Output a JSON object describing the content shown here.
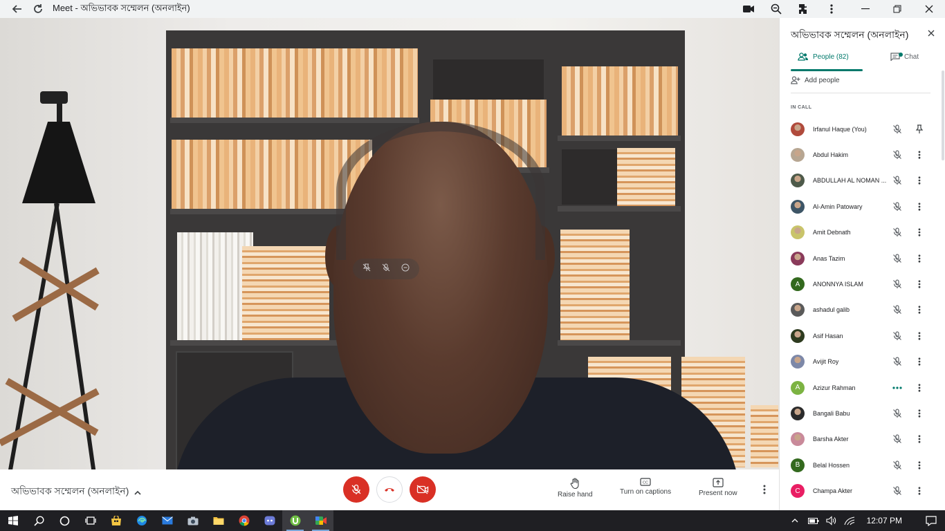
{
  "window": {
    "title": "Meet - অভিভাবক সম্মেলন (অনলাইন)"
  },
  "meeting": {
    "title": "অভিভাবক সম্মেলন (অনলাইন)"
  },
  "controls": {
    "raise_hand": "Raise hand",
    "captions": "Turn on captions",
    "present": "Present now"
  },
  "panel": {
    "title": "অভিভাবক সম্মেলন (অনলাইন)",
    "tab_people": "People (82)",
    "tab_chat": "Chat",
    "add_people": "Add people",
    "section_label": "IN CALL",
    "participants": [
      {
        "name": "Irfanul Haque (You)",
        "avatar": "photo",
        "color": "#b04a3c",
        "status": "muted",
        "action": "pin"
      },
      {
        "name": "Abdul Hakim",
        "avatar": "photo",
        "color": "#b7a692",
        "status": "muted",
        "action": "more"
      },
      {
        "name": "ABDULLAH AL NOMAN ...",
        "avatar": "photo",
        "color": "#4e5a4a",
        "status": "muted",
        "action": "more"
      },
      {
        "name": "Al-Amin Patowary",
        "avatar": "photo",
        "color": "#3d5566",
        "status": "muted",
        "action": "more"
      },
      {
        "name": "Amit Debnath",
        "avatar": "photo",
        "color": "#c9c46a",
        "status": "muted",
        "action": "more"
      },
      {
        "name": "Anas Tazim",
        "avatar": "photo",
        "color": "#8a3a5a",
        "status": "muted",
        "action": "more"
      },
      {
        "name": "ANONNYA ISLAM",
        "avatar": "letter",
        "letter": "A",
        "color": "#33691e",
        "status": "muted",
        "action": "more"
      },
      {
        "name": "ashadul galib",
        "avatar": "photo",
        "color": "#5a5a5a",
        "status": "muted",
        "action": "more"
      },
      {
        "name": "Asif Hasan",
        "avatar": "photo",
        "color": "#2e3b1f",
        "status": "muted",
        "action": "more"
      },
      {
        "name": "Avijit Roy",
        "avatar": "photo",
        "color": "#7d88a8",
        "status": "muted",
        "action": "more"
      },
      {
        "name": "Azizur Rahman",
        "avatar": "letter",
        "letter": "A",
        "color": "#7cb342",
        "status": "speaking",
        "action": "more"
      },
      {
        "name": "Bangali Babu",
        "avatar": "photo",
        "color": "#2b2b2b",
        "status": "muted",
        "action": "more"
      },
      {
        "name": "Barsha Akter",
        "avatar": "photo",
        "color": "#c98a9a",
        "status": "muted",
        "action": "more"
      },
      {
        "name": "Belal Hossen",
        "avatar": "letter",
        "letter": "B",
        "color": "#33691e",
        "status": "muted",
        "action": "more"
      },
      {
        "name": "Champa Akter",
        "avatar": "letter",
        "letter": "C",
        "color": "#e91e63",
        "status": "muted",
        "action": "more"
      }
    ]
  },
  "taskbar": {
    "time": "12:07 PM"
  },
  "colors": {
    "accent": "#00796b",
    "danger": "#d93025"
  }
}
